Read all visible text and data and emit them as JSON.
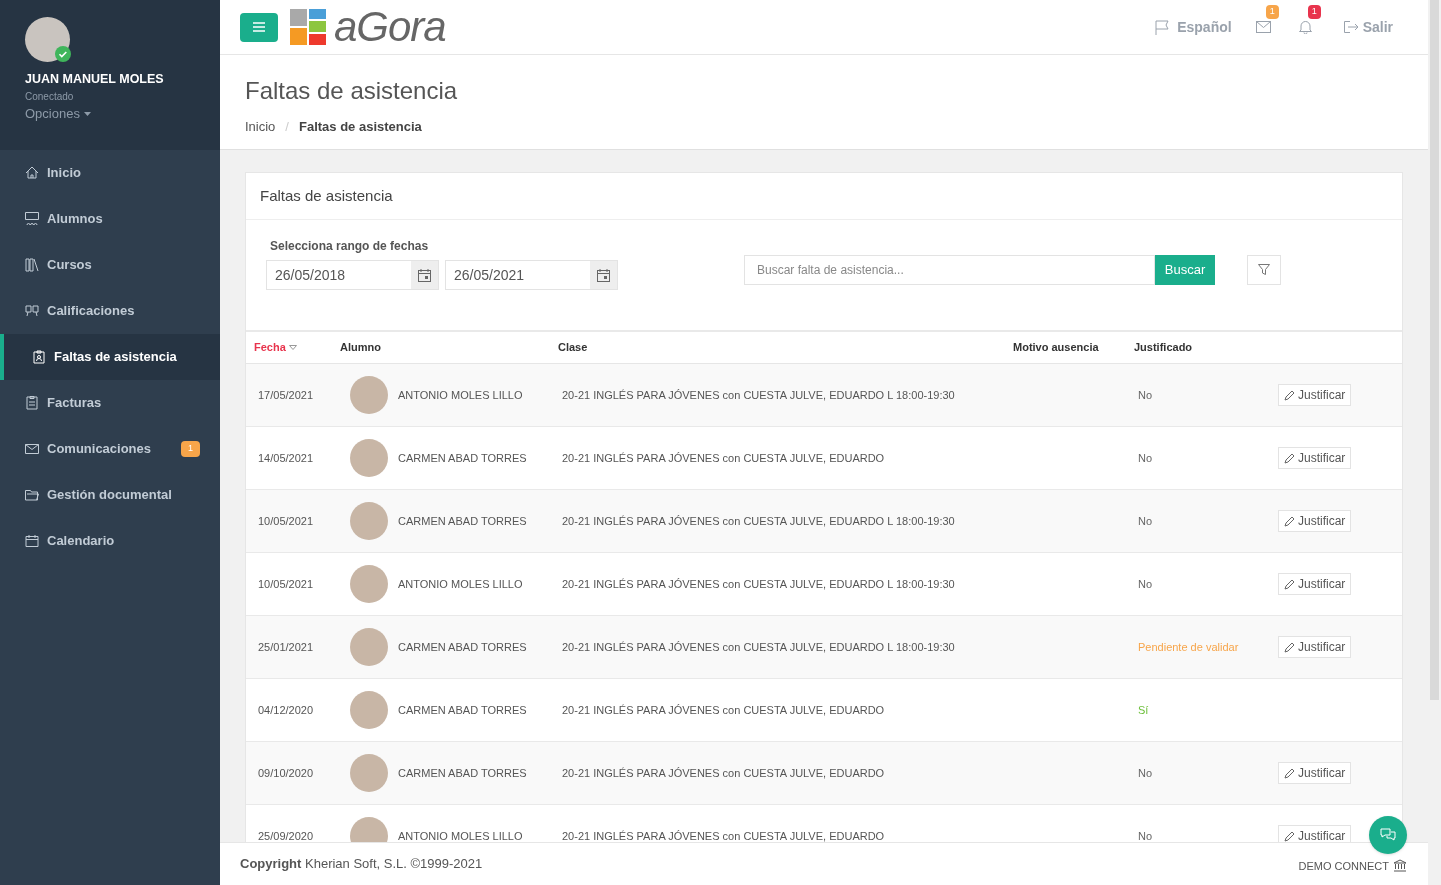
{
  "user": {
    "name": "JUAN MANUEL MOLES",
    "status": "Conectado",
    "options": "Opciones"
  },
  "sidebar": {
    "items": [
      {
        "label": "Inicio",
        "selected": false
      },
      {
        "label": "Alumnos",
        "selected": false
      },
      {
        "label": "Cursos",
        "selected": false
      },
      {
        "label": "Calificaciones",
        "selected": false
      },
      {
        "label": "Faltas de asistencia",
        "selected": true
      },
      {
        "label": "Facturas",
        "selected": false
      },
      {
        "label": "Comunicaciones",
        "selected": false,
        "badge": "1"
      },
      {
        "label": "Gestión documental",
        "selected": false
      },
      {
        "label": "Calendario",
        "selected": false
      }
    ]
  },
  "topbar": {
    "logo": "aGora",
    "language": "Español",
    "mail_badge": "1",
    "bell_badge": "1",
    "logout": "Salir"
  },
  "page": {
    "title": "Faltas de asistencia",
    "breadcrumb": [
      "Inicio",
      "Faltas de asistencia"
    ],
    "breadcrumb_separator": "/"
  },
  "card": {
    "title": "Faltas de asistencia",
    "range_label": "Selecciona rango de fechas",
    "date_from": "26/05/2018",
    "date_to": "26/05/2021",
    "search_placeholder": "Buscar falta de asistencia...",
    "search_button": "Buscar"
  },
  "table": {
    "columns": [
      {
        "label": "Fecha",
        "sorted": true
      },
      {
        "label": "Alumno",
        "sorted": false
      },
      {
        "label": "Clase",
        "sorted": false
      },
      {
        "label": "Motivo ausencia",
        "sorted": false
      },
      {
        "label": "Justificado",
        "sorted": false
      }
    ],
    "rows": [
      {
        "date": "17/05/2021",
        "student": "ANTONIO MOLES LILLO",
        "class": "20-21 INGLÉS PARA JÓVENES con CUESTA JULVE, EDUARDO L 18:00-19:30",
        "justified": "No",
        "kind": "no",
        "action": "Justificar"
      },
      {
        "date": "14/05/2021",
        "student": "CARMEN ABAD TORRES",
        "class": "20-21 INGLÉS PARA JÓVENES con CUESTA JULVE, EDUARDO",
        "justified": "No",
        "kind": "no",
        "action": "Justificar"
      },
      {
        "date": "10/05/2021",
        "student": "CARMEN ABAD TORRES",
        "class": "20-21 INGLÉS PARA JÓVENES con CUESTA JULVE, EDUARDO L 18:00-19:30",
        "justified": "No",
        "kind": "no",
        "action": "Justificar"
      },
      {
        "date": "10/05/2021",
        "student": "ANTONIO MOLES LILLO",
        "class": "20-21 INGLÉS PARA JÓVENES con CUESTA JULVE, EDUARDO L 18:00-19:30",
        "justified": "No",
        "kind": "no",
        "action": "Justificar"
      },
      {
        "date": "25/01/2021",
        "student": "CARMEN ABAD TORRES",
        "class": "20-21 INGLÉS PARA JÓVENES con CUESTA JULVE, EDUARDO L 18:00-19:30",
        "justified": "Pendiente de validar",
        "kind": "pending",
        "action": "Justificar"
      },
      {
        "date": "04/12/2020",
        "student": "CARMEN ABAD TORRES",
        "class": "20-21 INGLÉS PARA JÓVENES con CUESTA JULVE, EDUARDO",
        "justified": "Sí",
        "kind": "yes"
      },
      {
        "date": "09/10/2020",
        "student": "CARMEN ABAD TORRES",
        "class": "20-21 INGLÉS PARA JÓVENES con CUESTA JULVE, EDUARDO",
        "justified": "No",
        "kind": "no",
        "action": "Justificar"
      },
      {
        "date": "25/09/2020",
        "student": "ANTONIO MOLES LILLO",
        "class": "20-21 INGLÉS PARA JÓVENES con CUESTA JULVE, EDUARDO",
        "justified": "No",
        "kind": "no",
        "action": "Justificar"
      }
    ]
  },
  "footer": {
    "copyright_bold": "Copyright",
    "copyright": "Kherian Soft, S.L. ©1999-2021",
    "company": "DEMO CONNECT"
  }
}
